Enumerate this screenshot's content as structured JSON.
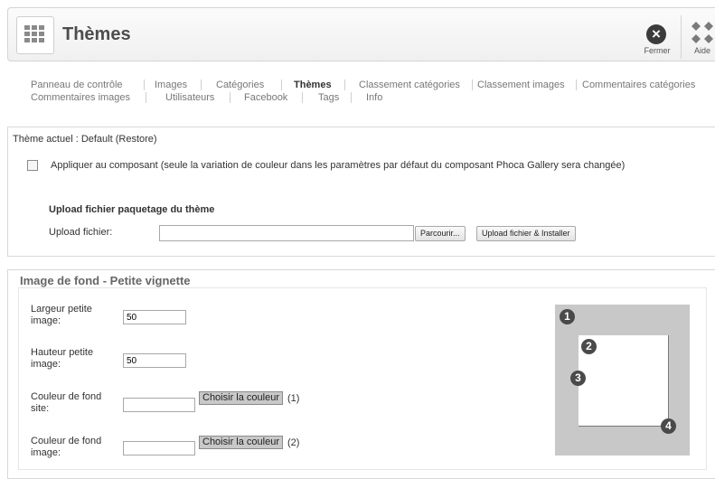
{
  "header": {
    "title": "Thèmes",
    "close_label": "Fermer",
    "help_label": "Aide"
  },
  "nav": {
    "row1": [
      {
        "label": "Panneau de contrôle",
        "active": false
      },
      {
        "label": "Images",
        "active": false
      },
      {
        "label": "Catégories",
        "active": false
      },
      {
        "label": "Thèmes",
        "active": true
      },
      {
        "label": "Classement catégories",
        "active": false
      },
      {
        "label": "Classement images",
        "active": false
      },
      {
        "label": "Commentaires catégories",
        "active": false
      }
    ],
    "row2": [
      {
        "label": "Commentaires images",
        "active": false
      },
      {
        "label": "Utilisateurs",
        "active": false
      },
      {
        "label": "Facebook",
        "active": false
      },
      {
        "label": "Tags",
        "active": false
      },
      {
        "label": "Info",
        "active": false
      }
    ]
  },
  "theme_panel": {
    "current_theme": "Thème actuel : Default (Restore)",
    "apply_label": "Appliquer au composant (seule la variation de couleur dans les paramètres par défaut du composant Phoca Gallery sera changée)",
    "apply_checked": false,
    "upload_heading": "Upload fichier paquetage du thème",
    "upload_label": "Upload fichier:",
    "upload_value": "",
    "browse_label": "Parcourir...",
    "install_label": "Upload fichier & Installer"
  },
  "thumb_panel": {
    "legend": "Image de fond - Petite vignette",
    "width_label": "Largeur petite image:",
    "width_value": "50",
    "height_label": "Hauteur petite image:",
    "height_value": "50",
    "site_bg_label": "Couleur de fond site:",
    "site_bg_value": "",
    "site_bg_button": "Choisir la couleur",
    "site_bg_ref": "(1)",
    "image_bg_label": "Couleur de fond image:",
    "image_bg_value": "",
    "image_bg_button": "Choisir la couleur",
    "image_bg_ref": "(2)"
  },
  "preview": {
    "markers": [
      "1",
      "2",
      "3",
      "4"
    ]
  }
}
